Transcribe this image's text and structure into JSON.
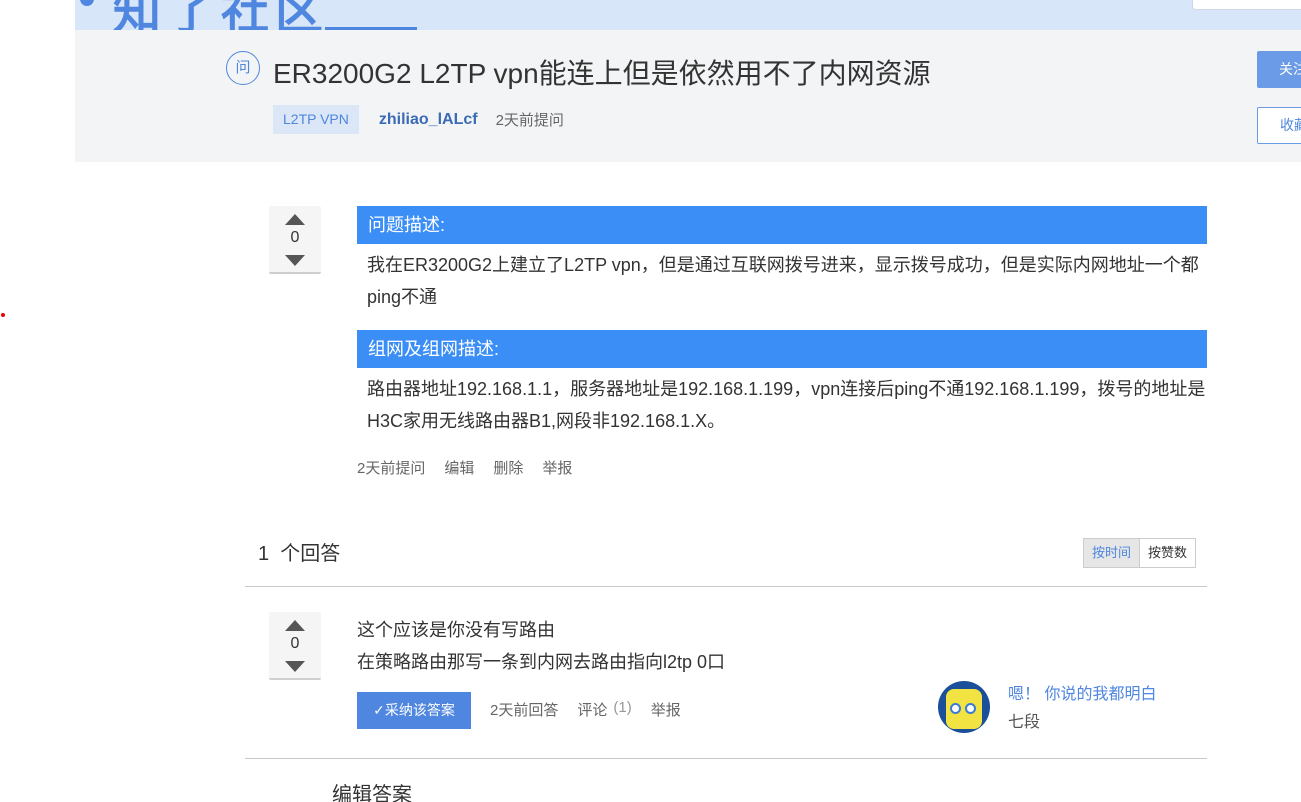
{
  "banner": {
    "logo_text": "知了社区"
  },
  "question": {
    "badge": "问",
    "title": "ER3200G2 L2TP vpn能连上但是依然用不了内网资源",
    "tag": "L2TP VPN",
    "author": "zhiliao_lALcf",
    "asked_time": "2天前提问",
    "follow_label": "关注",
    "collect_label": "收藏",
    "votes": "0",
    "sections": [
      {
        "heading": "问题描述:",
        "body": "我在ER3200G2上建立了L2TP vpn，但是通过互联网拨号进来，显示拨号成功，但是实际内网地址一个都ping不通"
      },
      {
        "heading": "组网及组网描述:",
        "body": "路由器地址192.168.1.1，服务器地址是192.168.1.199，vpn连接后ping不通192.168.1.199，拨号的地址是H3C家用无线路由器B1,网段非192.168.1.X。"
      }
    ],
    "actions": [
      "2天前提问",
      "编辑",
      "删除",
      "举报"
    ]
  },
  "answers_header": {
    "count_text": "1  个回答",
    "sort_by_time": "按时间",
    "sort_by_votes": "按赞数"
  },
  "answer": {
    "votes": "0",
    "line1": "这个应该是你没有写路由",
    "line2": "在策略路由那写一条到内网去路由指向l2tp 0口",
    "accept_label": "✓采纳该答案",
    "answered_time": "2天前回答",
    "comment_label": "评论",
    "comment_count": "(1)",
    "report_label": "举报",
    "user_signature": "嗯！ 你说的我都明白",
    "user_rank": "七段"
  },
  "edit_answer_label": "编辑答案",
  "colors": {
    "accent": "#4f86df",
    "section_header": "#3a8ef6",
    "header_bg": "#f3f4f6"
  }
}
